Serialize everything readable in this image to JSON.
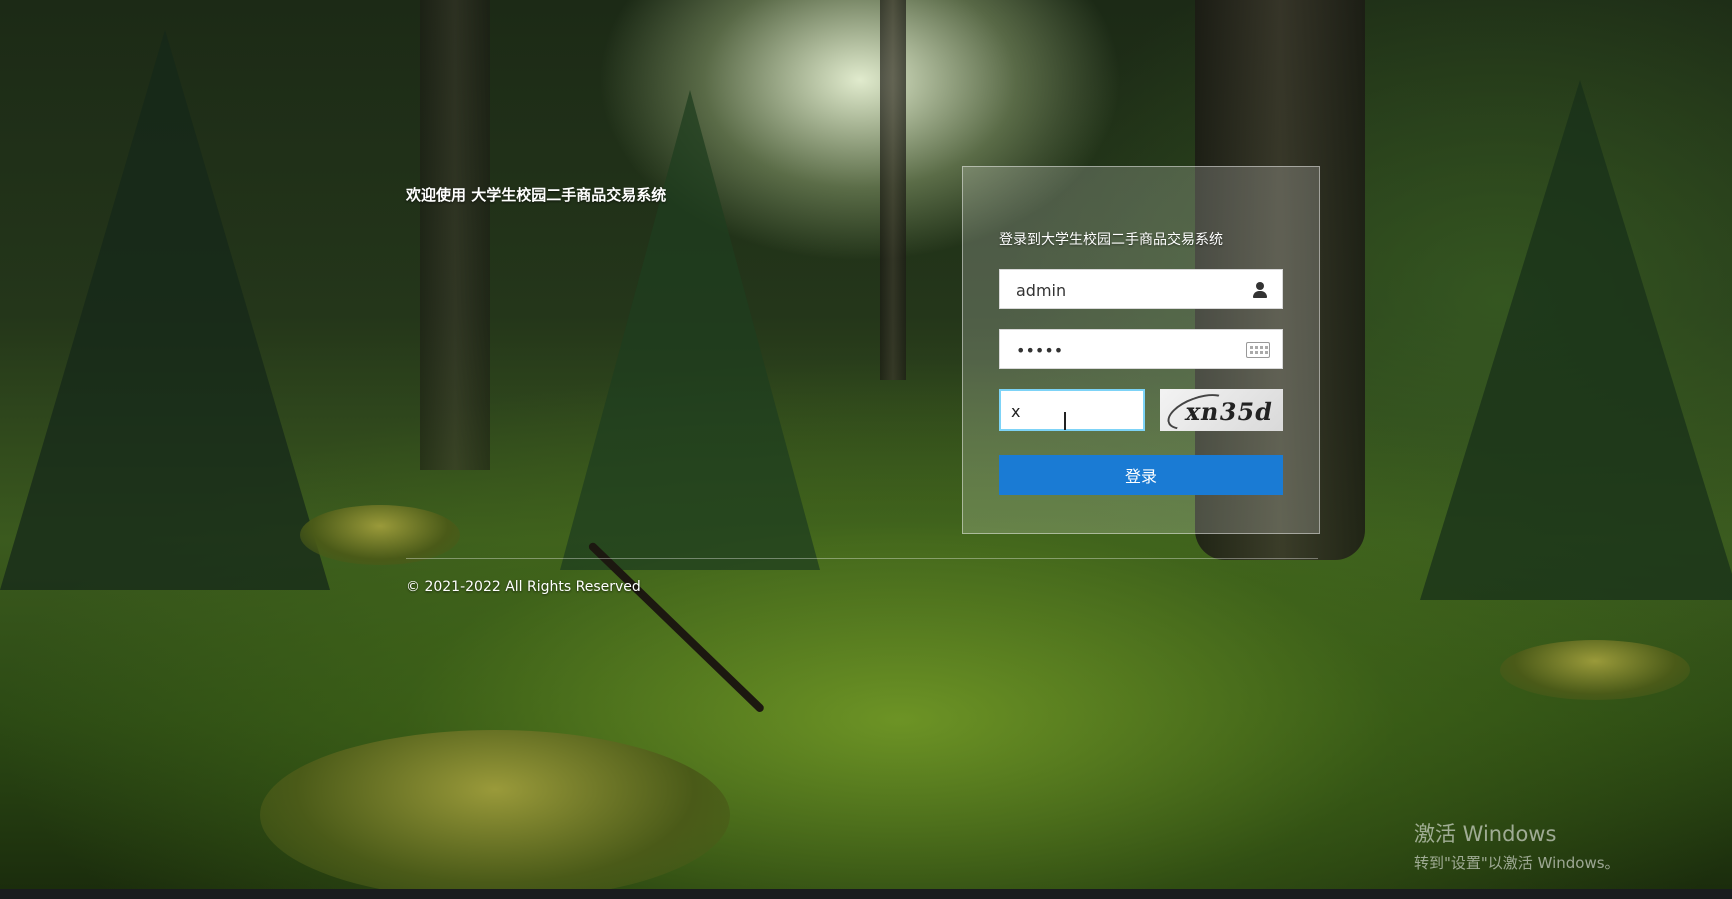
{
  "page": {
    "welcome_text": "欢迎使用 大学生校园二手商品交易系统",
    "copyright": "© 2021-2022 All Rights Reserved"
  },
  "login": {
    "title": "登录到大学生校园二手商品交易系统",
    "username_value": "admin",
    "password_value": "•••••",
    "captcha_value": "x",
    "captcha_image_text": "xn35d",
    "submit_label": "登录",
    "icons": {
      "username": "user-icon",
      "password": "keyboard-icon"
    }
  },
  "system_overlay": {
    "activate_title": "激活 Windows",
    "activate_hint": "转到\"设置\"以激活 Windows。"
  },
  "colors": {
    "button": "#1a7bd4",
    "captcha_focus_border": "#7dd3f7"
  }
}
